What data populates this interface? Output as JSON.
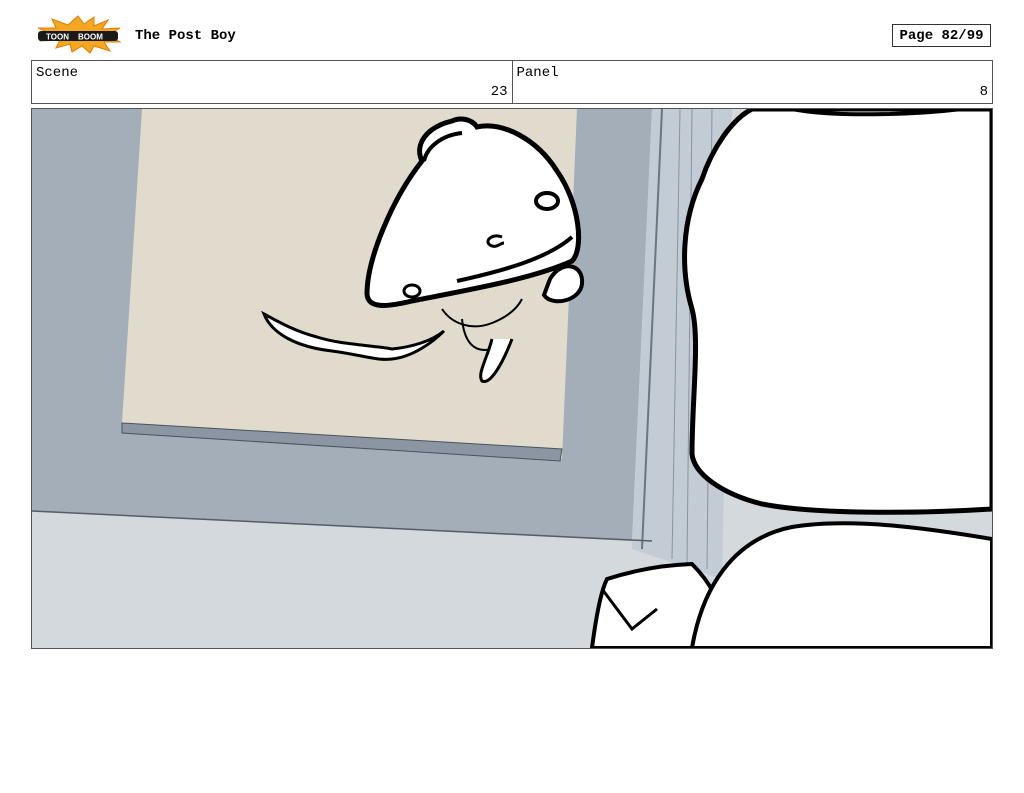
{
  "header": {
    "logo_text_left": "TOON",
    "logo_text_right": "BOOM",
    "title": "The Post Boy",
    "page_label": "Page 82/99"
  },
  "info": {
    "scene_label": "Scene",
    "scene_value": "23",
    "panel_label": "Panel",
    "panel_value": "8"
  },
  "panel_image": {
    "icon": "storyboard-drawing",
    "colors": {
      "wall": "#a3aeb9",
      "floor": "#d3d9dd",
      "poster": "#e0dbcd",
      "ink": "#000000",
      "door": "#c3ccd4"
    }
  }
}
